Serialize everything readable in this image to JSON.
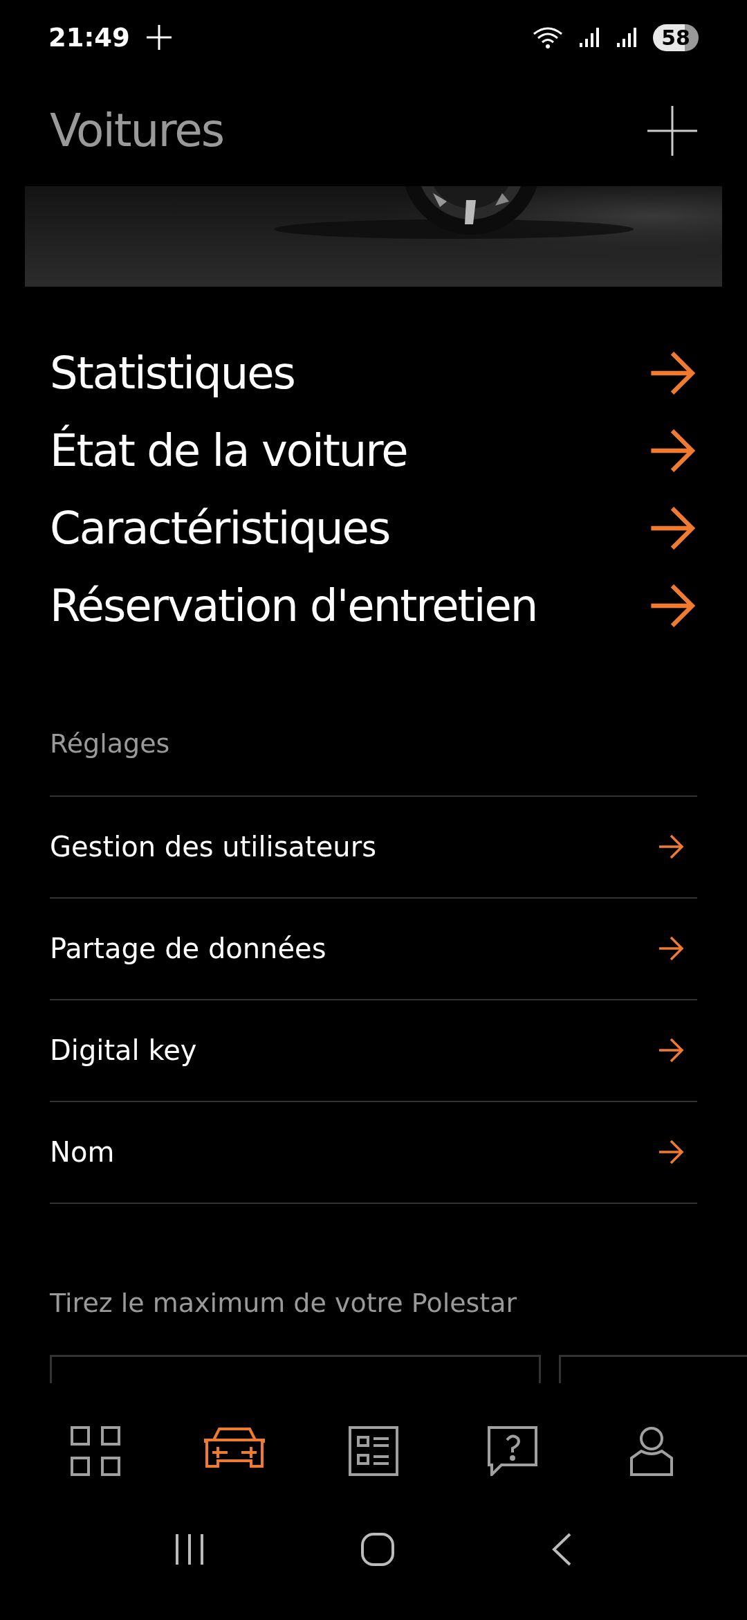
{
  "status_bar": {
    "time": "21:49",
    "battery": "58"
  },
  "header": {
    "title": "Voitures"
  },
  "car_links": [
    {
      "label": "Statistiques"
    },
    {
      "label": "État de la voiture"
    },
    {
      "label": "Caractéristiques"
    },
    {
      "label": "Réservation d'entretien"
    }
  ],
  "settings": {
    "title": "Réglages",
    "items": [
      {
        "label": "Gestion des utilisateurs"
      },
      {
        "label": "Partage de données"
      },
      {
        "label": "Digital key"
      },
      {
        "label": "Nom"
      }
    ]
  },
  "promo": {
    "title": "Tirez le maximum de votre Polestar"
  },
  "bottom_nav": {
    "items": [
      {
        "selected": false
      },
      {
        "selected": true
      },
      {
        "selected": false
      },
      {
        "selected": false
      },
      {
        "selected": false
      }
    ]
  }
}
